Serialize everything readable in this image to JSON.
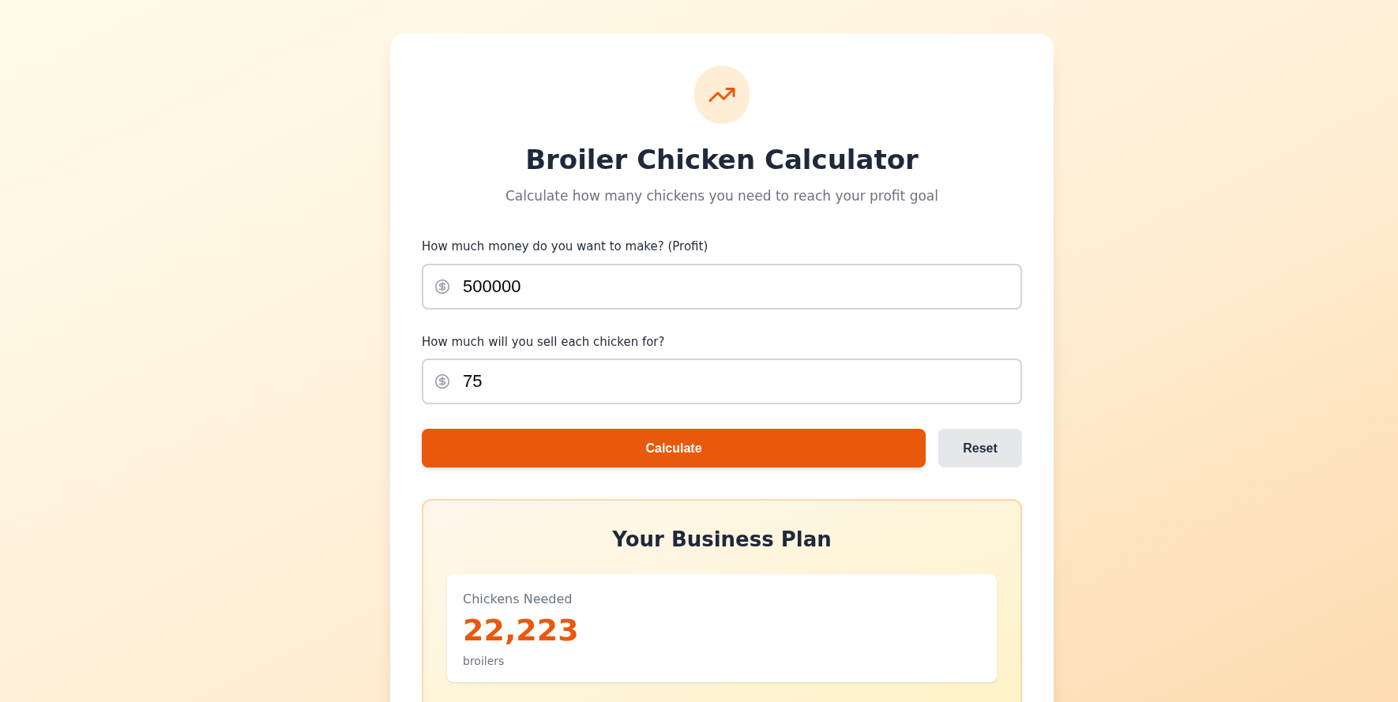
{
  "header": {
    "title": "Broiler Chicken Calculator",
    "subtitle": "Calculate how many chickens you need to reach your profit goal"
  },
  "fields": [
    {
      "label": "How much money do you want to make? (Profit)",
      "value": "500000"
    },
    {
      "label": "How much will you sell each chicken for?",
      "value": "75"
    }
  ],
  "buttons": [
    {
      "label": "Calculate",
      "kind": "primary"
    },
    {
      "label": "Reset",
      "kind": "secondary"
    }
  ],
  "results": {
    "title": "Your Business Plan",
    "stats": [
      {
        "label": "Chickens Needed",
        "value": "22,223",
        "unit": "broilers"
      }
    ]
  }
}
